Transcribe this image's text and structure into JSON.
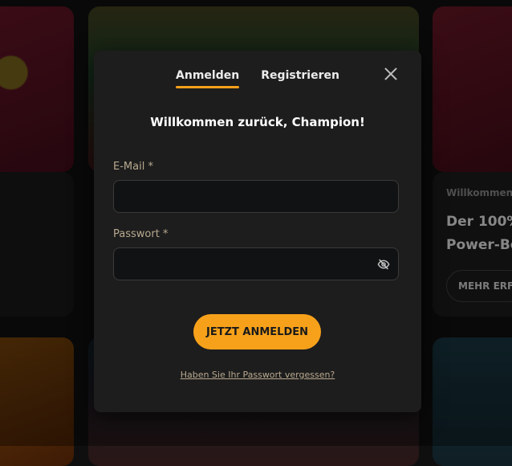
{
  "background": {
    "promo_kicker": "Willkommens",
    "promo_title_line1": "Der 100%",
    "promo_title_line2": "Power-Bo",
    "promo_button": "MEHR ERF"
  },
  "modal": {
    "tabs": [
      {
        "label": "Anmelden",
        "active": true
      },
      {
        "label": "Registrieren",
        "active": false
      }
    ],
    "welcome": "Willkommen zurück, Champion!",
    "email": {
      "label": "E-Mail *",
      "value": "",
      "placeholder": ""
    },
    "password": {
      "label": "Passwort *",
      "value": "",
      "placeholder": ""
    },
    "submit_label": "JETZT ANMELDEN",
    "forgot_link": "Haben Sie Ihr Passwort vergessen?"
  },
  "colors": {
    "accent": "#f7a11a",
    "modal_bg": "#1d1d1d",
    "input_bg": "#111213",
    "label": "#b8a98f"
  }
}
